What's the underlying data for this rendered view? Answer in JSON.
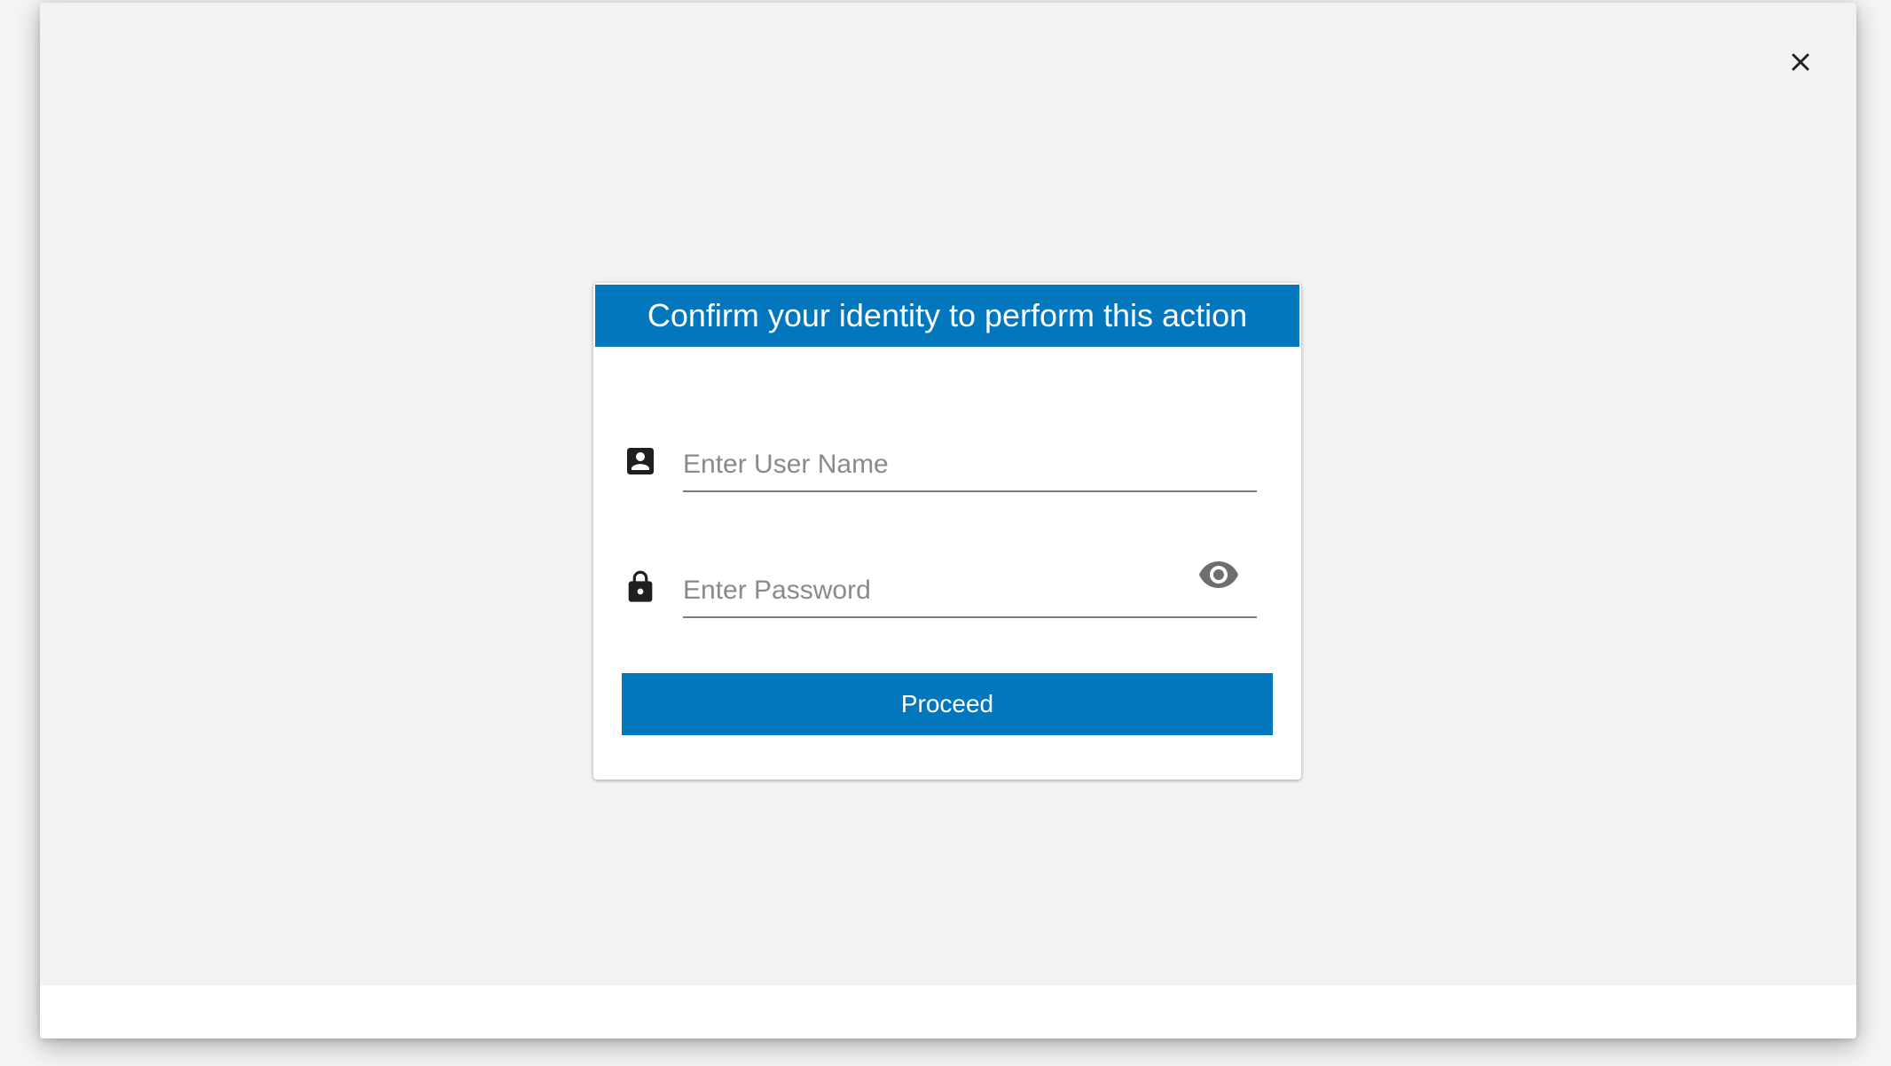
{
  "dialog": {
    "title": "Confirm your identity to perform this action",
    "username": {
      "placeholder": "Enter User Name",
      "value": "",
      "icon": "account-box-icon"
    },
    "password": {
      "placeholder": "Enter Password",
      "value": "",
      "icon": "lock-icon",
      "toggle_icon": "eye-icon"
    },
    "proceed_label": "Proceed"
  },
  "overlay": {
    "close_icon": "close-icon"
  },
  "colors": {
    "accent": "#0277bd",
    "backdrop": "#f2f2f1",
    "card": "#ffffff",
    "icon_dark": "#1f1f1f",
    "icon_muted": "#6e6e6e",
    "placeholder": "#8a8a8a"
  }
}
